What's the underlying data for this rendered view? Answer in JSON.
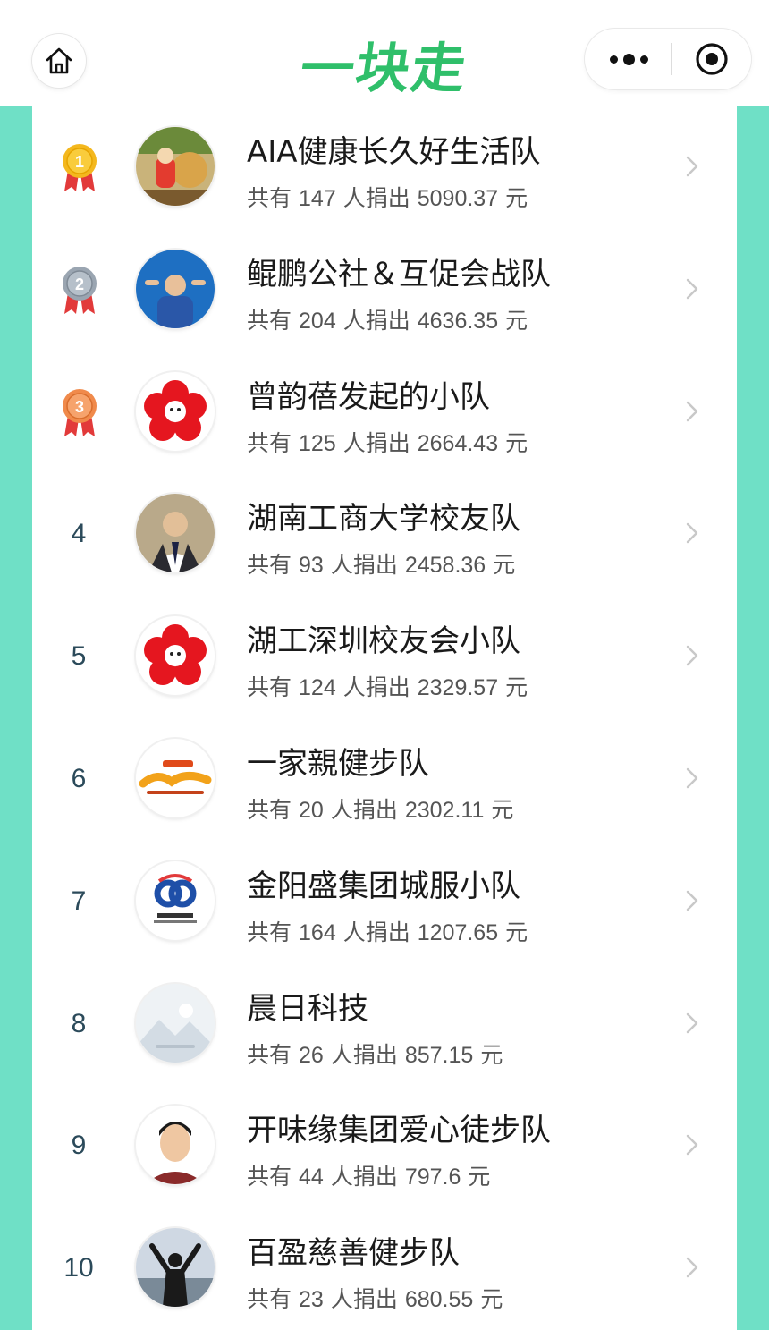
{
  "header": {
    "title": "一块走",
    "home_icon": "home-icon",
    "more_icon": "more-dots-icon",
    "close_icon": "target-close-icon"
  },
  "colors": {
    "title_green": "#2fbf6a",
    "side_bar": "#6fe0c6",
    "medal_gold": "#f4b81e",
    "medal_silver": "#9aa5b1",
    "medal_bronze": "#f08a4b",
    "ribbon_red": "#e23a3a"
  },
  "stats_labels": {
    "prefix": "共有",
    "people": "人捐出",
    "currency": "元"
  },
  "teams": [
    {
      "rank": "1",
      "name": "AIA健康长久好生活队",
      "members": "147",
      "amount": "5090.37",
      "avatar": "doll-avatar"
    },
    {
      "rank": "2",
      "name": "鲲鹏公社＆互促会战队",
      "members": "204",
      "amount": "4636.35",
      "avatar": "man-blue-shirt-avatar"
    },
    {
      "rank": "3",
      "name": "曾韵蓓发起的小队",
      "members": "125",
      "amount": "2664.43",
      "avatar": "red-flower-avatar"
    },
    {
      "rank": "4",
      "name": "湖南工商大学校友队",
      "members": "93",
      "amount": "2458.36",
      "avatar": "man-suit-avatar"
    },
    {
      "rank": "5",
      "name": "湖工深圳校友会小队",
      "members": "124",
      "amount": "2329.57",
      "avatar": "red-flower-avatar"
    },
    {
      "rank": "6",
      "name": "一家親健步队",
      "members": "20",
      "amount": "2302.11",
      "avatar": "yijiaqin-logo-avatar"
    },
    {
      "rank": "7",
      "name": "金阳盛集团城服小队",
      "members": "164",
      "amount": "1207.65",
      "avatar": "jinyangsheng-logo-avatar"
    },
    {
      "rank": "8",
      "name": "晨日科技",
      "members": "26",
      "amount": "857.15",
      "avatar": "placeholder-mountain-avatar"
    },
    {
      "rank": "9",
      "name": "开味缘集团爱心徒步队",
      "members": "44",
      "amount": "797.6",
      "avatar": "man-portrait-avatar"
    },
    {
      "rank": "10",
      "name": "百盈慈善健步队",
      "members": "23",
      "amount": "680.55",
      "avatar": "person-arms-raised-avatar"
    }
  ]
}
